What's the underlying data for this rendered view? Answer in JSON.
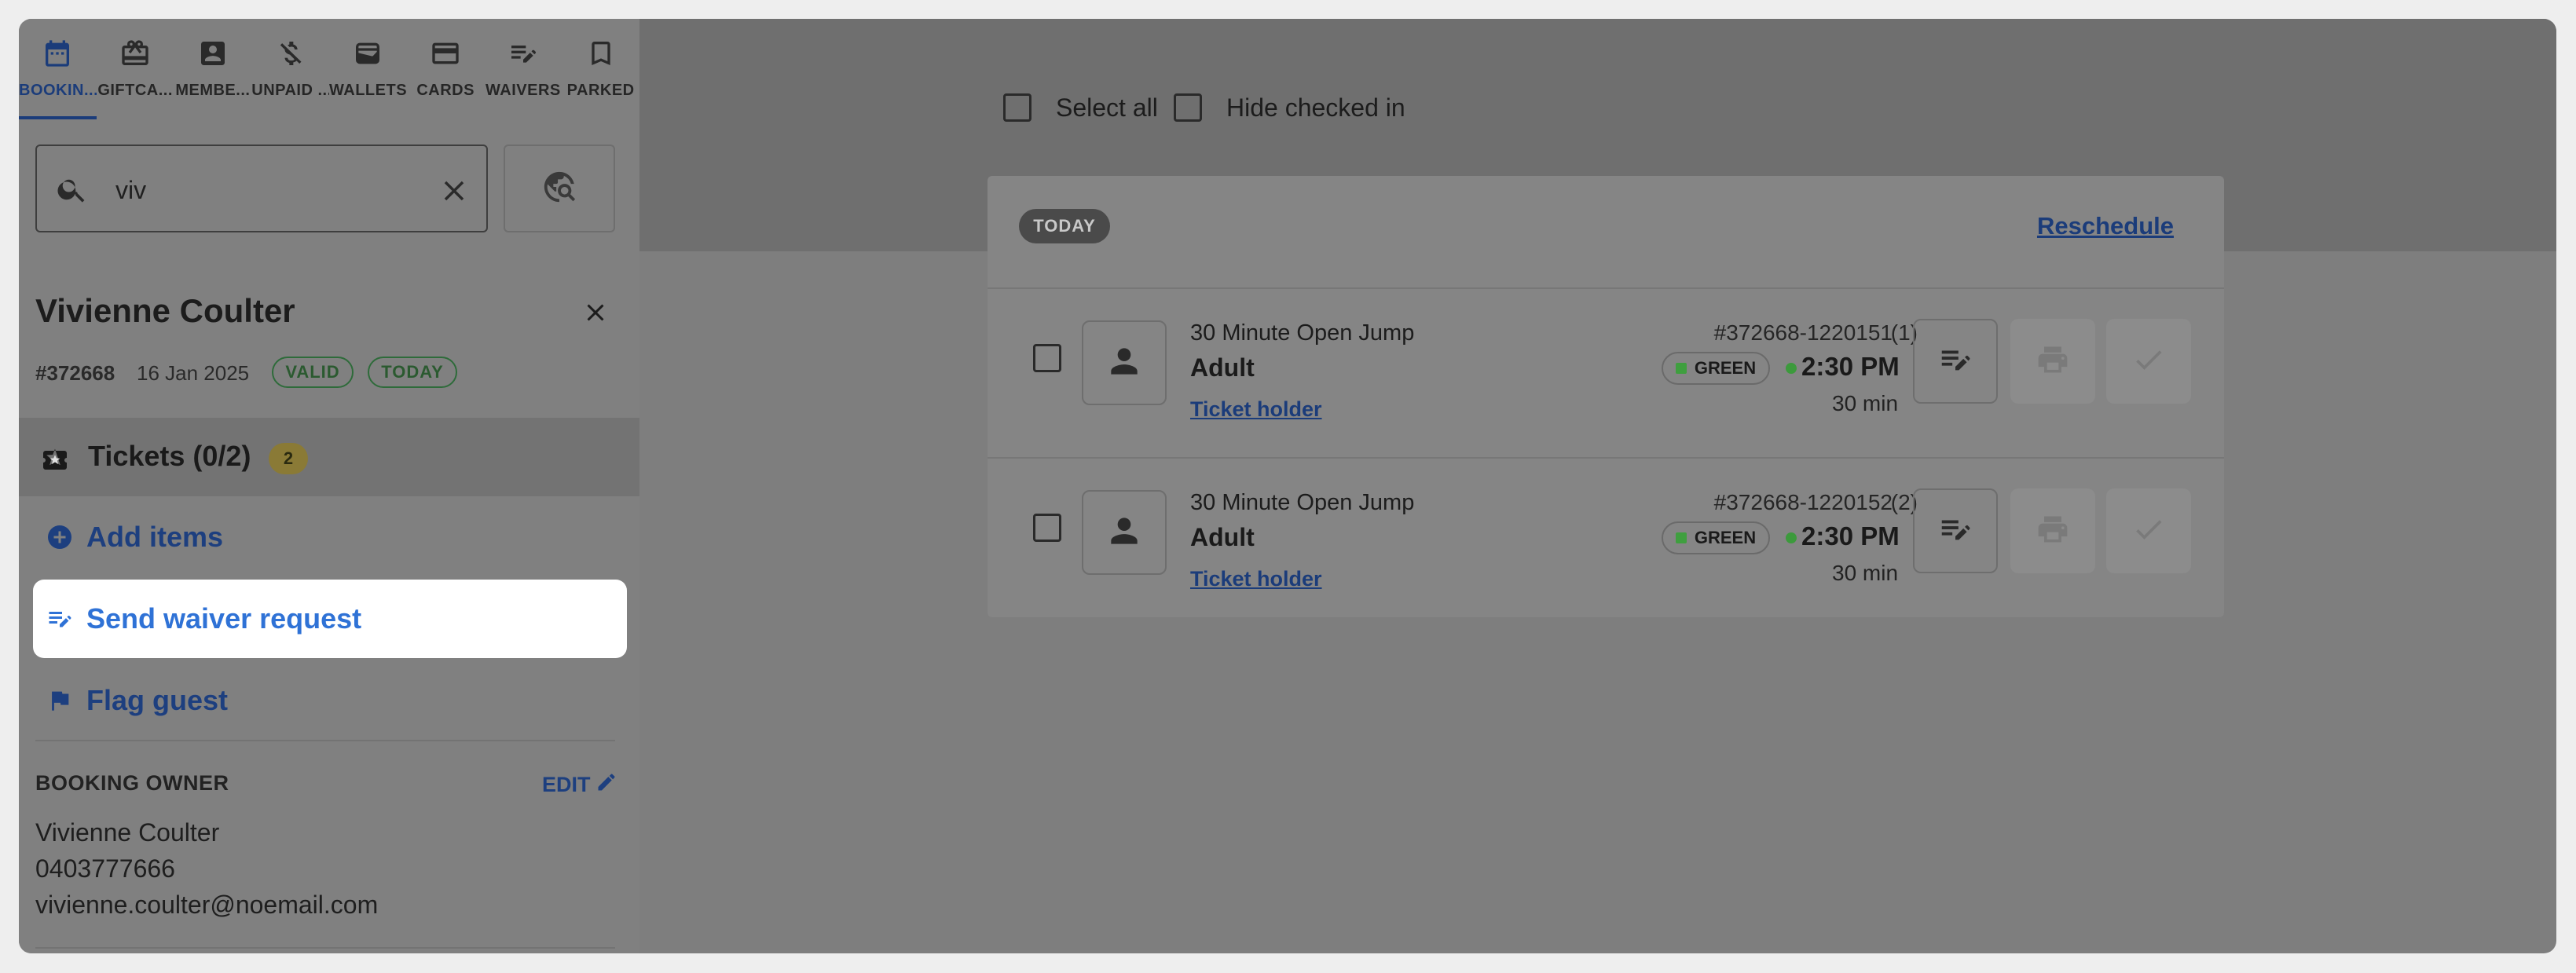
{
  "nav_tabs": [
    {
      "label": "BOOKIN...",
      "icon": "calendar-icon",
      "active": true
    },
    {
      "label": "GIFTCA...",
      "icon": "gift-card-icon",
      "active": false
    },
    {
      "label": "MEMBE...",
      "icon": "member-badge-icon",
      "active": false
    },
    {
      "label": "UNPAID ...",
      "icon": "money-off-icon",
      "active": false
    },
    {
      "label": "WALLETS",
      "icon": "wallet-icon",
      "active": false
    },
    {
      "label": "CARDS",
      "icon": "credit-card-icon",
      "active": false
    },
    {
      "label": "WAIVERS",
      "icon": "waiver-edit-icon",
      "active": false
    },
    {
      "label": "PARKED",
      "icon": "bookmark-icon",
      "active": false
    }
  ],
  "search": {
    "value": "viv"
  },
  "guest": {
    "name": "Vivienne Coulter",
    "booking_id": "#372668",
    "date": "16 Jan 2025",
    "status_valid": "VALID",
    "status_today": "TODAY"
  },
  "tickets": {
    "label": "Tickets (0/2)",
    "count": "2"
  },
  "actions": {
    "add_items": "Add items",
    "send_waiver": "Send waiver request",
    "flag_guest": "Flag guest"
  },
  "owner": {
    "title": "BOOKING OWNER",
    "edit_label": "EDIT",
    "name": "Vivienne Coulter",
    "phone": "0403777666",
    "email": "vivienne.coulter@noemail.com"
  },
  "toolbar": {
    "select_all": "Select all",
    "hide_checked_in": "Hide checked in"
  },
  "card": {
    "day_chip": "TODAY",
    "reschedule": "Reschedule",
    "rows": [
      {
        "product": "30 Minute Open Jump",
        "type": "Adult",
        "holder": "Ticket holder",
        "ticket_id": "#372668-1220151",
        "index": "(1)",
        "band": "GREEN",
        "time": "2:30 PM",
        "duration": "30 min"
      },
      {
        "product": "30 Minute Open Jump",
        "type": "Adult",
        "holder": "Ticket holder",
        "ticket_id": "#372668-1220152",
        "index": "(2)",
        "band": "GREEN",
        "time": "2:30 PM",
        "duration": "30 min"
      }
    ]
  },
  "colors": {
    "accent": "#1b3c7a",
    "highlight_link": "#2f72d6",
    "band_green": "#3f9f3f",
    "overlay": "#7e7e7e"
  }
}
